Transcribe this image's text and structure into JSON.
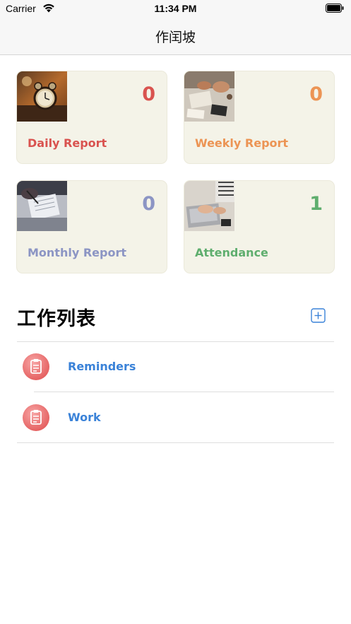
{
  "status_bar": {
    "carrier": "Carrier",
    "time": "11:34 PM"
  },
  "nav": {
    "title": "作闰坡"
  },
  "cards": [
    {
      "label": "Daily Report",
      "count": "0",
      "color": "#d9534f",
      "image": "alarm-clock-photo"
    },
    {
      "label": "Weekly Report",
      "count": "0",
      "color": "#ec9454",
      "image": "desk-meeting-photo"
    },
    {
      "label": "Monthly Report",
      "count": "0",
      "color": "#8c95c4",
      "image": "writing-notebook-photo"
    },
    {
      "label": "Attendance",
      "count": "1",
      "color": "#5fae6e",
      "image": "laptop-typing-photo"
    }
  ],
  "section": {
    "title": "工作列表",
    "add_icon": "plus-square-icon",
    "accent": "#3a82d8"
  },
  "list": [
    {
      "label": "Reminders",
      "icon": "clipboard-icon"
    },
    {
      "label": "Work",
      "icon": "clipboard-icon"
    }
  ]
}
